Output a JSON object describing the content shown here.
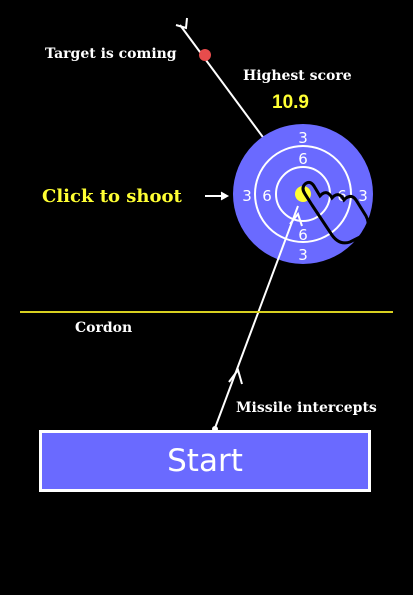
{
  "game": {
    "target_label": "Target is coming",
    "highest_score_label": "Highest score",
    "highest_score_value": "10.9",
    "click_label": "Click to shoot",
    "cordon_label": "Cordon",
    "missile_label": "Missile intercepts",
    "start_label": "Start",
    "ring_outer": "3",
    "ring_inner": "6"
  },
  "colors": {
    "background": "#000000",
    "accent_yellow": "#ffff33",
    "target_blue": "#6a6aff",
    "incoming_target": "#e74c4c",
    "cordon_line": "#d8d020",
    "button_fill": "#6a6aff"
  },
  "icons": {
    "pointer": "hand-pointer-icon",
    "arrow": "arrow-right-icon"
  }
}
